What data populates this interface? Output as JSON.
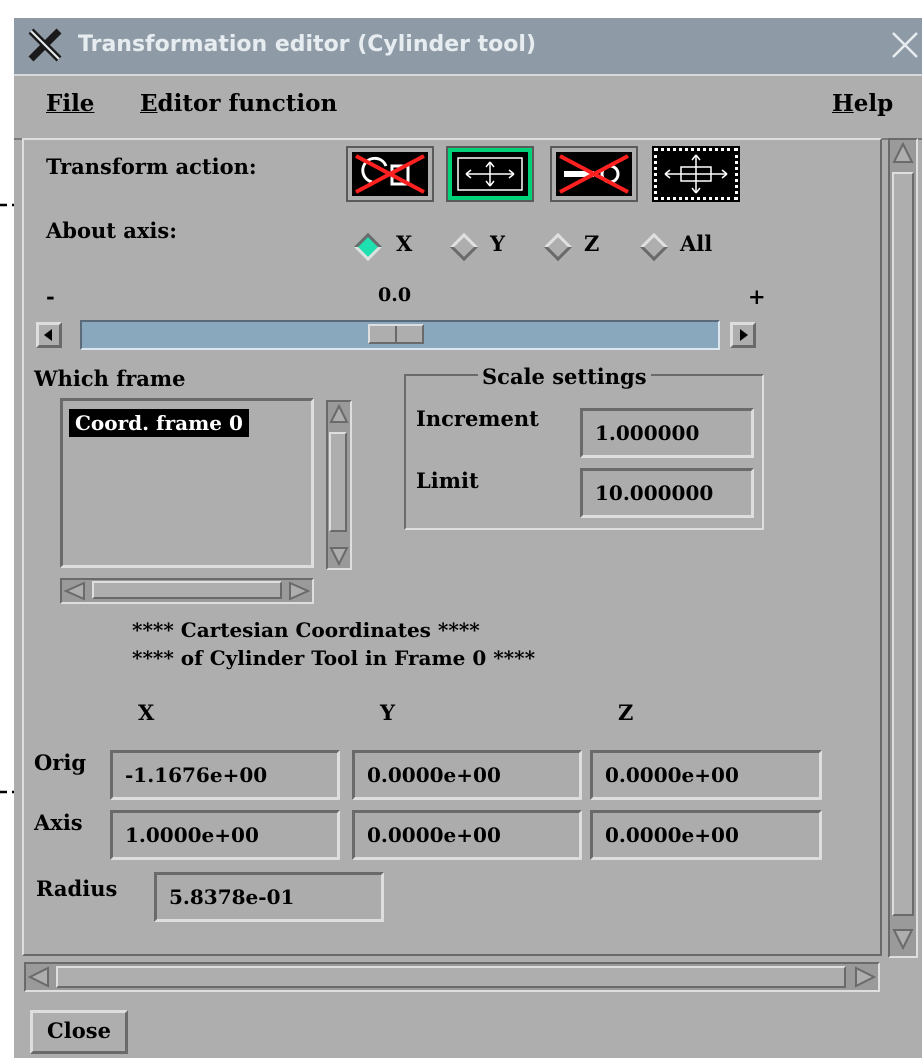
{
  "window": {
    "title": "Transformation editor (Cylinder tool)"
  },
  "menu": {
    "file": "File",
    "editor_function": "Editor function",
    "help": "Help"
  },
  "transform": {
    "label": "Transform action:"
  },
  "axis": {
    "label": "About axis:",
    "options": [
      "X",
      "Y",
      "Z",
      "All"
    ],
    "selected": "X"
  },
  "slider": {
    "minus": "-",
    "value_text": "0.0",
    "plus": "+",
    "value_fraction": 0.5
  },
  "frame": {
    "label": "Which frame",
    "items": [
      "Coord. frame 0"
    ],
    "selected": "Coord. frame 0"
  },
  "scale": {
    "title": "Scale settings",
    "increment_label": "Increment",
    "increment_value": "1.000000",
    "limit_label": "Limit",
    "limit_value": "10.000000"
  },
  "coords": {
    "header_line1": "**** Cartesian Coordinates ****",
    "header_line2": "**** of Cylinder Tool in Frame 0 ****",
    "col_x": "X",
    "col_y": "Y",
    "col_z": "Z",
    "orig_label": "Orig",
    "orig_x": "-1.1676e+00",
    "orig_y": "0.0000e+00",
    "orig_z": "0.0000e+00",
    "axis_label": "Axis",
    "axis_x": "1.0000e+00",
    "axis_y": "0.0000e+00",
    "axis_z": "0.0000e+00",
    "radius_label": "Radius",
    "radius_value": "5.8378e-01"
  },
  "close_label": "Close",
  "colors": {
    "titlebar": "#8e9ba6",
    "window_bg": "#aeaeae",
    "selected_radio": "#1fe0b0",
    "icon_highlight": "#00d27a",
    "cross_out": "#ff2020"
  }
}
